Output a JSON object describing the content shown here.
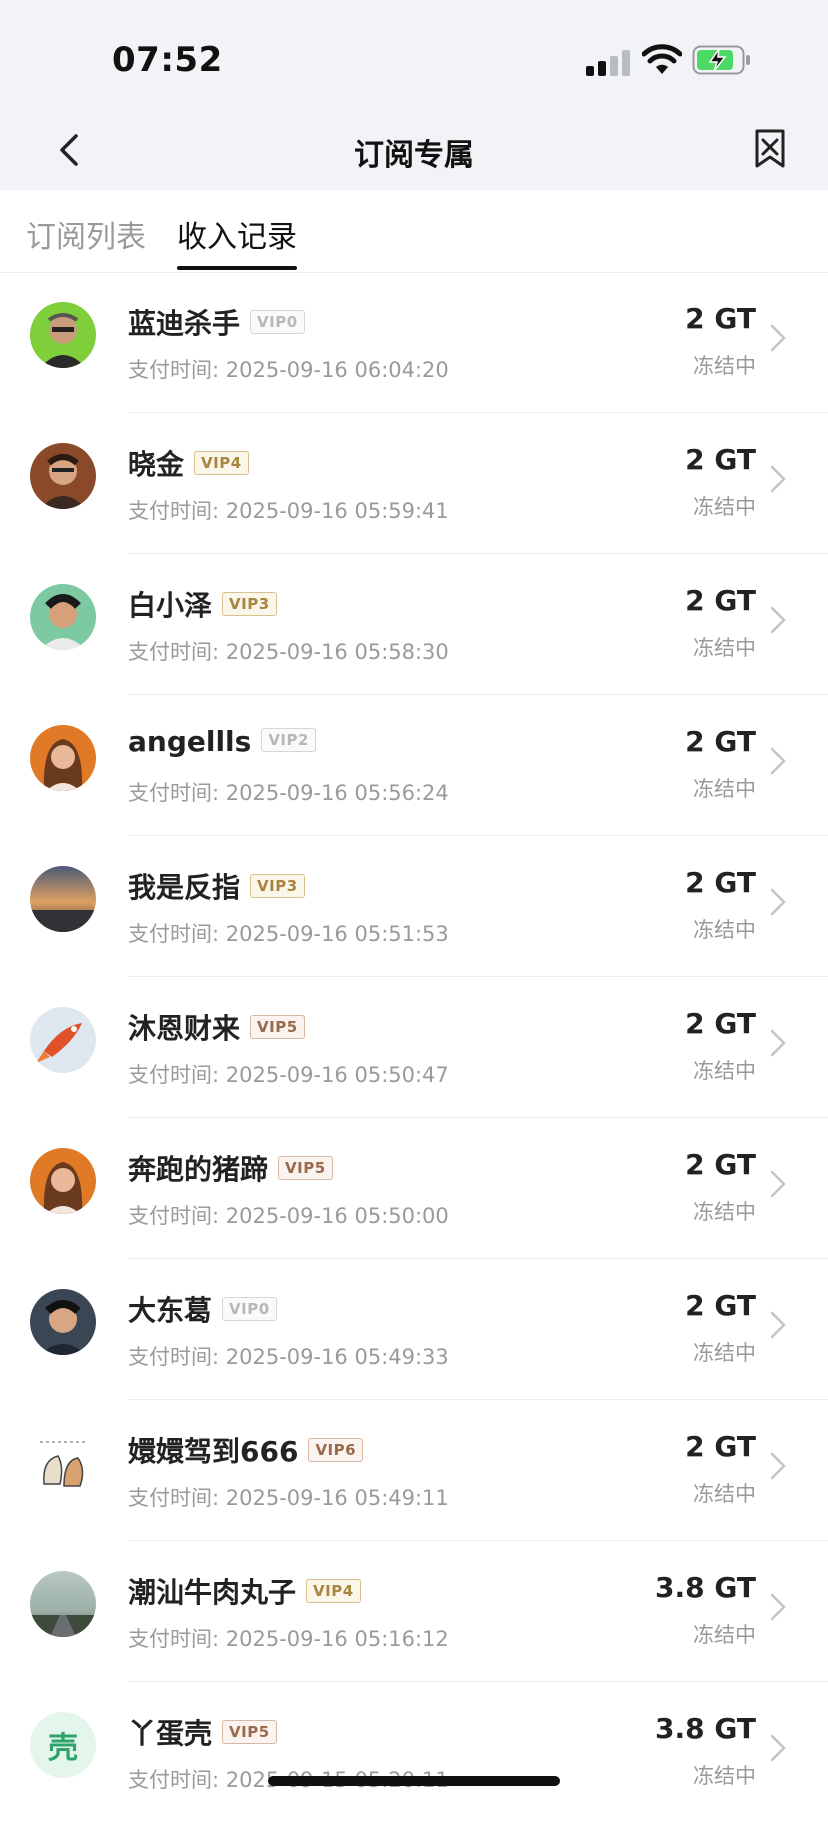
{
  "status_bar": {
    "time": "07:52"
  },
  "nav": {
    "title": "订阅专属"
  },
  "tabs": [
    {
      "label": "订阅列表",
      "active": false
    },
    {
      "label": "收入记录",
      "active": true
    }
  ],
  "records": [
    {
      "name": "蓝迪杀手",
      "vip": "VIP0",
      "pay_time": "支付时间: 2025-09-16 06:04:20",
      "amount": "2 GT",
      "status": "冻结中"
    },
    {
      "name": "晓金",
      "vip": "VIP4",
      "pay_time": "支付时间: 2025-09-16 05:59:41",
      "amount": "2 GT",
      "status": "冻结中"
    },
    {
      "name": "白小泽",
      "vip": "VIP3",
      "pay_time": "支付时间: 2025-09-16 05:58:30",
      "amount": "2 GT",
      "status": "冻结中"
    },
    {
      "name": "angellls",
      "vip": "VIP2",
      "pay_time": "支付时间: 2025-09-16 05:56:24",
      "amount": "2 GT",
      "status": "冻结中"
    },
    {
      "name": "我是反指",
      "vip": "VIP3",
      "pay_time": "支付时间: 2025-09-16 05:51:53",
      "amount": "2 GT",
      "status": "冻结中"
    },
    {
      "name": "沐恩财来",
      "vip": "VIP5",
      "pay_time": "支付时间: 2025-09-16 05:50:47",
      "amount": "2 GT",
      "status": "冻结中"
    },
    {
      "name": "奔跑的猪蹄",
      "vip": "VIP5",
      "pay_time": "支付时间: 2025-09-16 05:50:00",
      "amount": "2 GT",
      "status": "冻结中"
    },
    {
      "name": "大东葛",
      "vip": "VIP0",
      "pay_time": "支付时间: 2025-09-16 05:49:33",
      "amount": "2 GT",
      "status": "冻结中"
    },
    {
      "name": "嬛嬛驾到666",
      "vip": "VIP6",
      "pay_time": "支付时间: 2025-09-16 05:49:11",
      "amount": "2 GT",
      "status": "冻结中"
    },
    {
      "name": "潮汕牛肉丸子",
      "vip": "VIP4",
      "pay_time": "支付时间: 2025-09-16 05:16:12",
      "amount": "3.8 GT",
      "status": "冻结中"
    },
    {
      "name": "丫蛋壳",
      "vip": "VIP5",
      "pay_time": "支付时间: 2025-09-15 05:20:11",
      "amount": "3.8 GT",
      "status": "冻结中",
      "avatar_text": "壳"
    }
  ],
  "colors": {
    "header_bg": "#f1f3f6",
    "vip0": "#b8b8b8",
    "vip_gold": "#a8843f",
    "vip_brown": "#9a6a4c",
    "secondary_text": "#9a9a9a"
  }
}
